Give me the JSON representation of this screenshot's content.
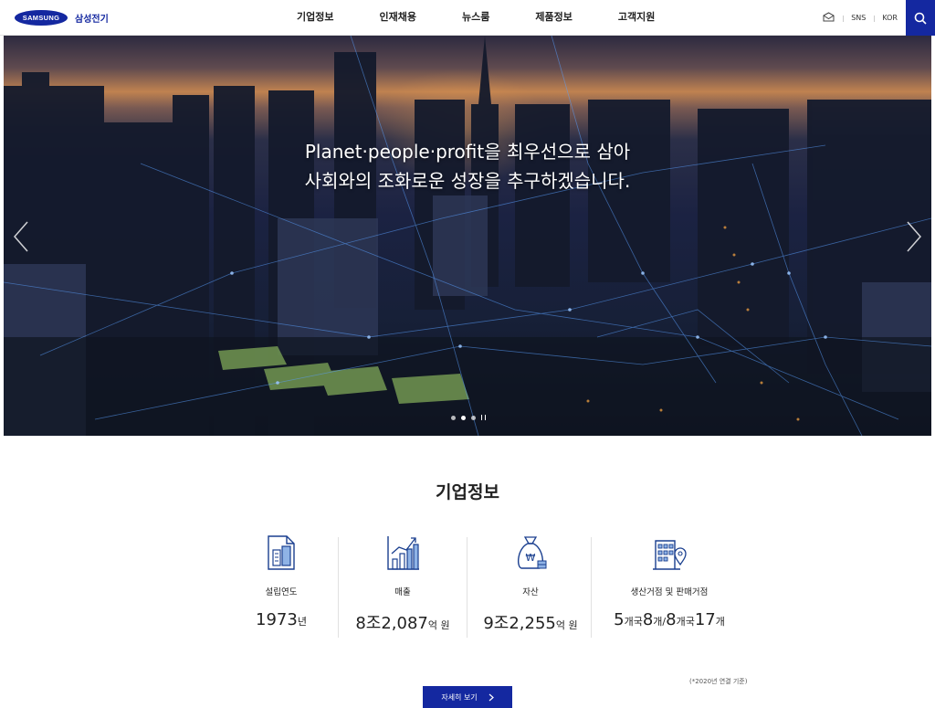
{
  "header": {
    "logo_mark": "SAMSUNG",
    "logo_text": "삼성전기",
    "nav": [
      "기업정보",
      "인재채용",
      "뉴스룸",
      "제품정보",
      "고객지원"
    ],
    "util": {
      "sns": "SNS",
      "lang": "KOR"
    },
    "icons": {
      "mail": "mail-icon",
      "search": "search-icon"
    }
  },
  "hero": {
    "line1": "Planet·people·profit을 최우선으로 삼아",
    "line2": "사회와의 조화로운 성장을 추구하겠습니다.",
    "slide_count": 3,
    "active_slide": 2
  },
  "company": {
    "title": "기업정보",
    "stats": [
      {
        "label": "설립연도",
        "value_num": "1973",
        "value_unit": "년",
        "icon": "document-building-icon"
      },
      {
        "label": "매출",
        "value_num": "8조2,087",
        "value_unit": "억 원",
        "icon": "bar-chart-icon"
      },
      {
        "label": "자산",
        "value_num": "9조2,255",
        "value_unit": "억 원",
        "icon": "money-bag-icon"
      },
      {
        "label": "생산거점 및 판매거점",
        "value_a": "5",
        "value_a_unit": "개국",
        "value_b": "8",
        "value_b_unit": "개/",
        "value_c": "8",
        "value_c_unit": "개국",
        "value_d": "17",
        "value_d_unit": "개",
        "icon": "building-location-icon"
      }
    ],
    "note": "(*2020년 연결 기준)",
    "more_label": "자세히 보기"
  },
  "colors": {
    "brand": "#1428a0"
  }
}
